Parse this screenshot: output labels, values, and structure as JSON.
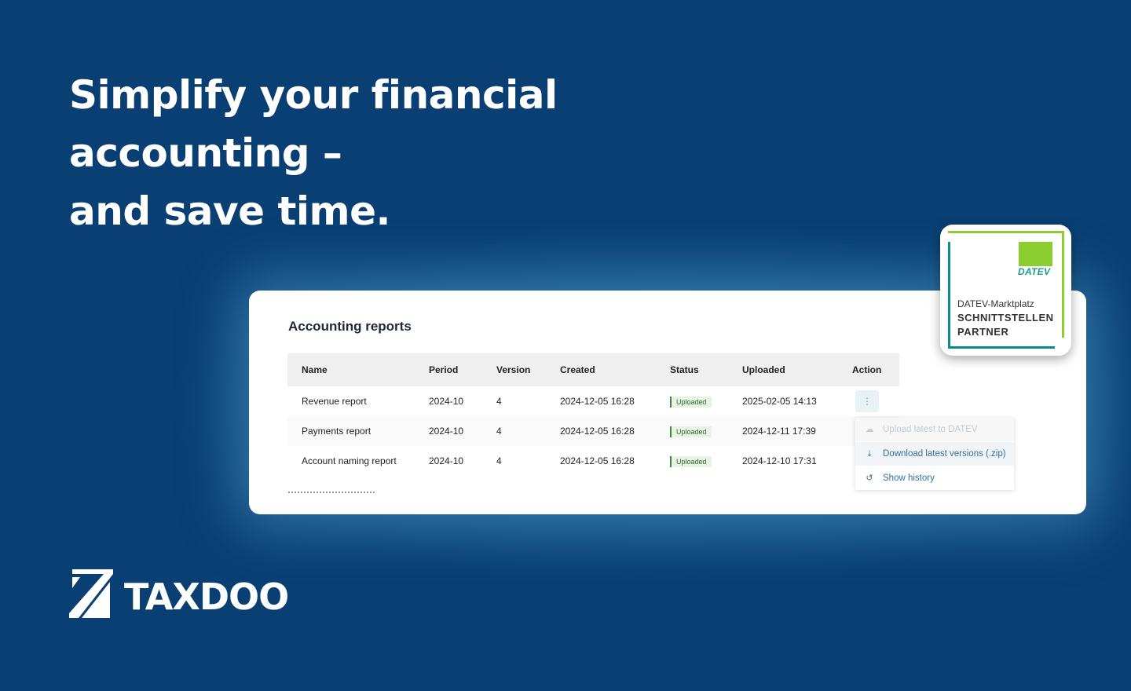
{
  "hero": {
    "line1": "Simplify your financial accounting –",
    "line2": "and save time."
  },
  "card": {
    "title": "Accounting reports",
    "columns": [
      "Name",
      "Period",
      "Version",
      "Created",
      "Status",
      "Uploaded",
      "Action"
    ],
    "rows": [
      {
        "name": "Revenue report",
        "period": "2024-10",
        "version": "4",
        "created": "2024-12-05 16:28",
        "status": "Uploaded",
        "uploaded": "2025-02-05 14:13"
      },
      {
        "name": "Payments report",
        "period": "2024-10",
        "version": "4",
        "created": "2024-12-05 16:28",
        "status": "Uploaded",
        "uploaded": "2024-12-11 17:39"
      },
      {
        "name": "Account naming report",
        "period": "2024-10",
        "version": "4",
        "created": "2024-12-05 16:28",
        "status": "Uploaded",
        "uploaded": "2024-12-10 17:31"
      }
    ],
    "action_icon": "kebab-menu-icon",
    "menu": [
      {
        "label": "Upload latest to DATEV",
        "icon": "cloud-upload-icon",
        "disabled": true
      },
      {
        "label": "Download latest versions (.zip)",
        "icon": "download-icon",
        "disabled": false
      },
      {
        "label": "Show history",
        "icon": "history-icon",
        "disabled": false
      }
    ]
  },
  "datev_badge": {
    "brand": "DATEV",
    "line1": "DATEV-Marktplatz",
    "line2": "SCHNITTSTELLEN",
    "line3": "PARTNER",
    "colors": {
      "green": "#8ccd2f",
      "teal": "#0a8b8c"
    }
  },
  "logo": {
    "wordmark": "TAXDOO"
  },
  "colors": {
    "background": "#093f73",
    "link": "#2f6f9f",
    "status_green": "#3b8a3b"
  }
}
